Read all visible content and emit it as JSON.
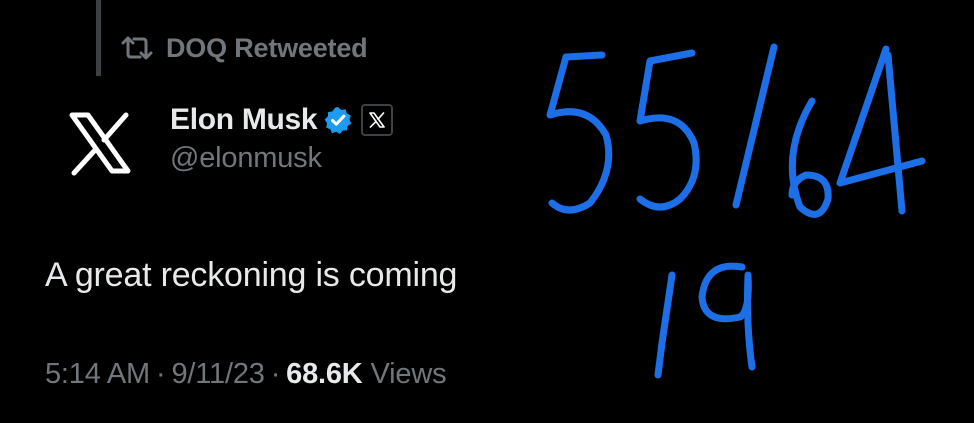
{
  "retweet": {
    "icon": "retweet-icon",
    "text": "DOQ Retweeted"
  },
  "author": {
    "avatar_icon": "x-logo-icon",
    "display_name": "Elon Musk",
    "verified_icon": "verified-badge-icon",
    "affiliate_icon": "x-affiliate-badge-icon",
    "handle": "@elonmusk"
  },
  "tweet": {
    "text": "A great reckoning is coming"
  },
  "meta": {
    "time": "5:14 AM",
    "separator": "·",
    "date": "9/11/23",
    "views_count": "68.6K",
    "views_label": "Views"
  },
  "annotation": {
    "line1": "55/64",
    "line2": "19",
    "ink_color": "#1d6fe8"
  },
  "colors": {
    "background": "#000000",
    "primary_text": "#e7e9ea",
    "secondary_text": "#71767b",
    "verified_blue": "#1d9bf0"
  }
}
